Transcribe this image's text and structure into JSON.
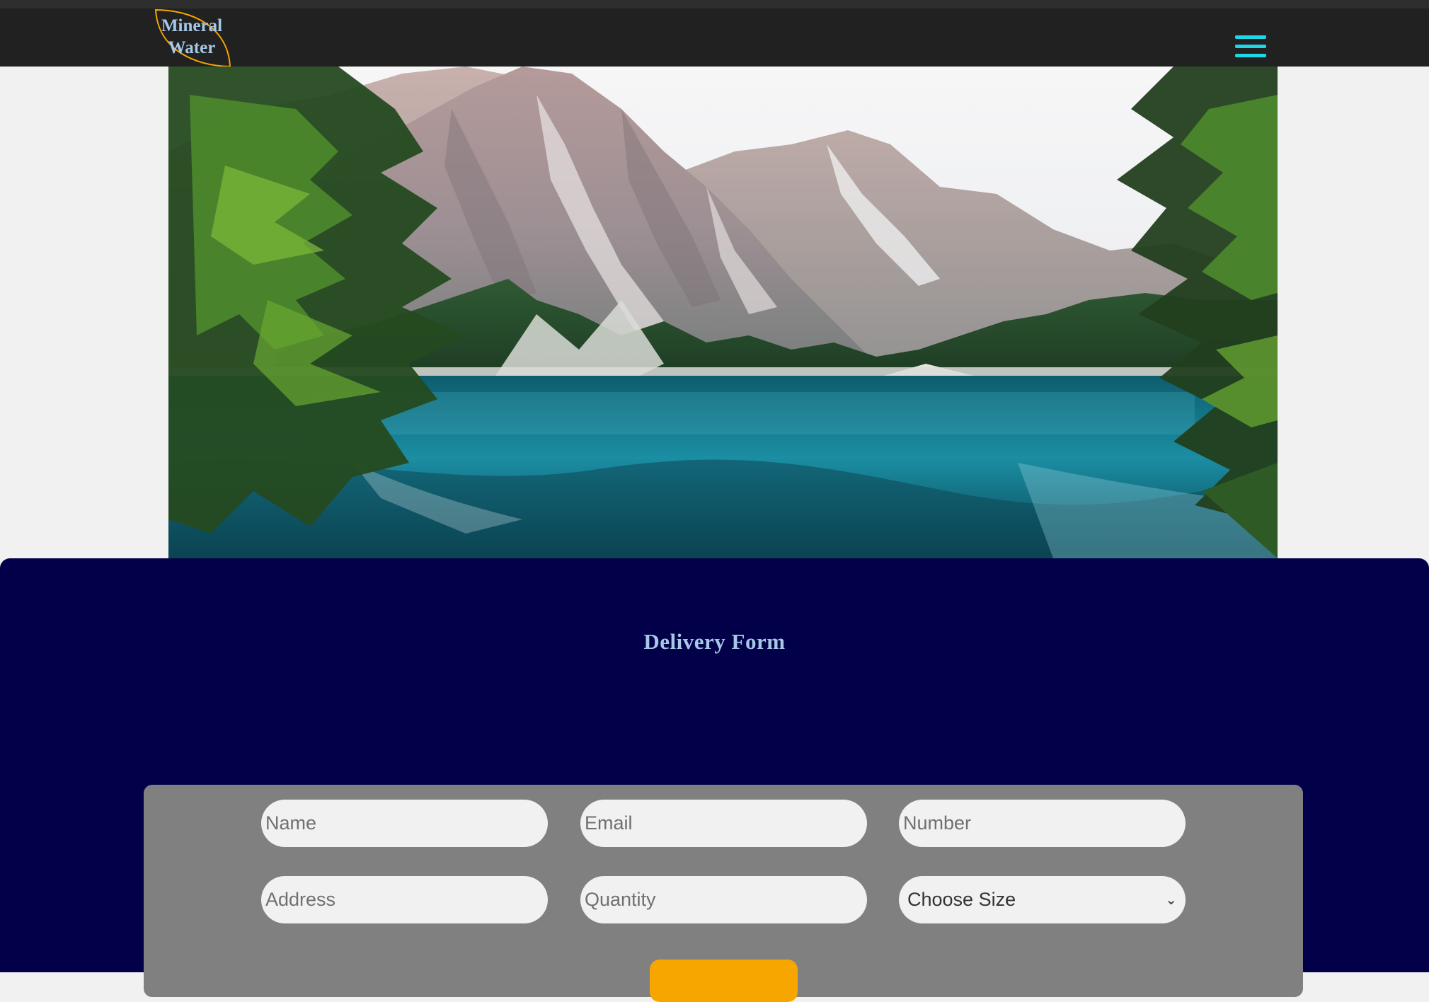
{
  "brand": {
    "line1": "Mineral",
    "line2": "Water",
    "text_color": "#a7c7e7",
    "outline_color": "#f7a600"
  },
  "nav": {
    "menu_icon": "hamburger-menu-icon",
    "menu_color": "#1ed7e6",
    "background": "#212121"
  },
  "hero": {
    "image": "mountain-lake-landscape"
  },
  "delivery_form": {
    "title": "Delivery Form",
    "background": "#010048",
    "fields": {
      "name_placeholder": "Name",
      "email_placeholder": "Email",
      "number_placeholder": "Number",
      "address_placeholder": "Address",
      "quantity_placeholder": "Quantity",
      "size_selected": "Choose Size",
      "size_icon": "chevron-down-icon"
    },
    "submit_color": "#f7a600"
  }
}
